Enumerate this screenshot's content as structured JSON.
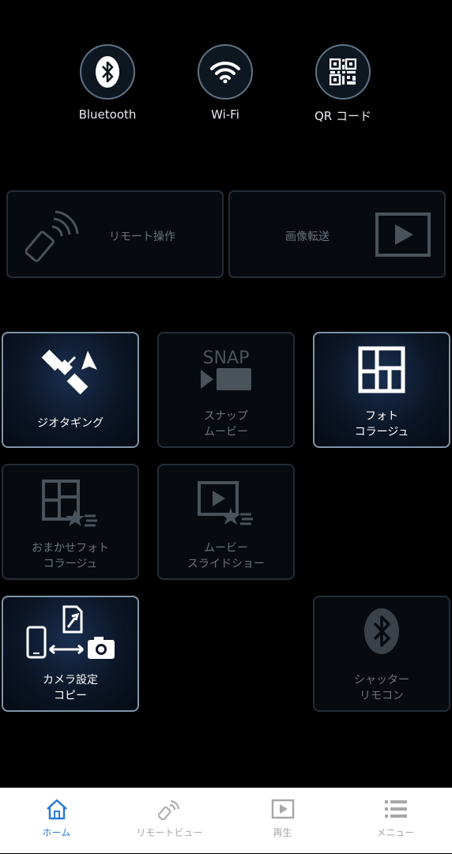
{
  "top_buttons": [
    {
      "label": "Bluetooth",
      "icon": "bluetooth-icon"
    },
    {
      "label": "Wi-Fi",
      "icon": "wifi-icon"
    },
    {
      "label": "QR コード",
      "icon": "qr-code-icon"
    }
  ],
  "wide_tiles": [
    {
      "label": "リモート操作",
      "icon": "remote-icon",
      "enabled": false
    },
    {
      "label": "画像転送",
      "icon": "play-icon",
      "enabled": false
    }
  ],
  "tiles": [
    {
      "label": "ジオタギング",
      "icon": "satellite-icon",
      "enabled": true
    },
    {
      "label": "スナップ\nムービー",
      "icon": "snap-movie-icon",
      "enabled": false
    },
    {
      "label": "フォト\nコラージュ",
      "icon": "photo-collage-icon",
      "enabled": true
    },
    {
      "label": "おまかせフォト\nコラージュ",
      "icon": "auto-collage-icon",
      "enabled": false
    },
    {
      "label": "ムービー\nスライドショー",
      "icon": "movie-slideshow-icon",
      "enabled": false
    },
    {
      "label": "カメラ設定\nコピー",
      "icon": "camera-settings-copy-icon",
      "enabled": true
    },
    {
      "label": "シャッター\nリモコン",
      "icon": "bluetooth-icon",
      "enabled": false
    }
  ],
  "snap_text": "SNAP",
  "tabbar": [
    {
      "label": "ホーム",
      "icon": "home-icon",
      "active": true
    },
    {
      "label": "リモートビュー",
      "icon": "remote-icon",
      "active": false
    },
    {
      "label": "再生",
      "icon": "play-icon",
      "active": false
    },
    {
      "label": "メニュー",
      "icon": "menu-icon",
      "active": false
    }
  ],
  "colors": {
    "active_tab": "#2a7ad6",
    "background": "#000000",
    "tile_border_active": "#8095a7"
  }
}
